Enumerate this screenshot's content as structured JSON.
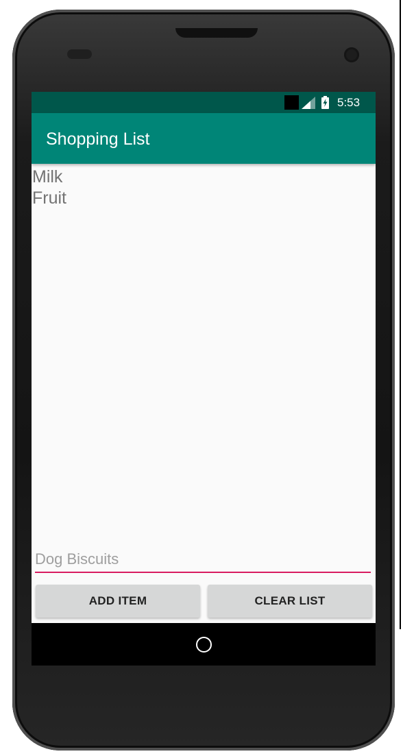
{
  "status_bar": {
    "time": "5:53",
    "icons": [
      "notification-block-icon",
      "cell-signal-icon",
      "battery-charging-icon"
    ]
  },
  "app_bar": {
    "title": "Shopping List"
  },
  "list": {
    "items": [
      "Milk",
      "Fruit"
    ]
  },
  "input": {
    "placeholder": "Dog Biscuits",
    "value": ""
  },
  "buttons": {
    "add_label": "ADD ITEM",
    "clear_label": "CLEAR LIST"
  },
  "nav_bar": {
    "icons": [
      "home-icon"
    ]
  },
  "colors": {
    "status_bar": "#00574b",
    "app_bar": "#008577",
    "accent": "#d81b60",
    "button": "#d6d7d7",
    "background": "#fafafa"
  }
}
